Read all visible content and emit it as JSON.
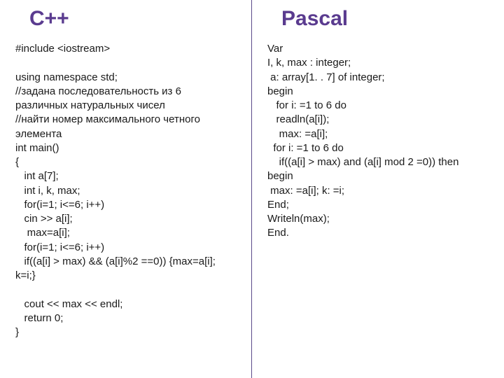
{
  "left": {
    "title": "С++",
    "code": "#include <iostream>\n\nusing namespace std;\n//задана последовательность из 6 различных натуральных чисел\n//найти номер максимального четного элемента\nint main()\n{\n   int a[7];\n   int i, k, max;\n   for(i=1; i<=6; i++)\n   cin >> a[i];\n    max=a[i];\n   for(i=1; i<=6; i++)\n   if((a[i] > max) && (a[i]%2 ==0)) {max=a[i]; k=i;}\n\n   cout << max << endl;\n   return 0;\n}"
  },
  "right": {
    "title": "Pascal",
    "code": "Var\nI, k, max : integer;\n a: array[1. . 7] of integer;\nbegin\n   for i: =1 to 6 do\n   readln(a[i]);\n    max: =a[i];\n  for i: =1 to 6 do\n    if((a[i] > max) and (a[i] mod 2 =0)) then\nbegin\n max: =a[i]; k: =i;\nEnd;\nWriteln(max);\nEnd."
  }
}
